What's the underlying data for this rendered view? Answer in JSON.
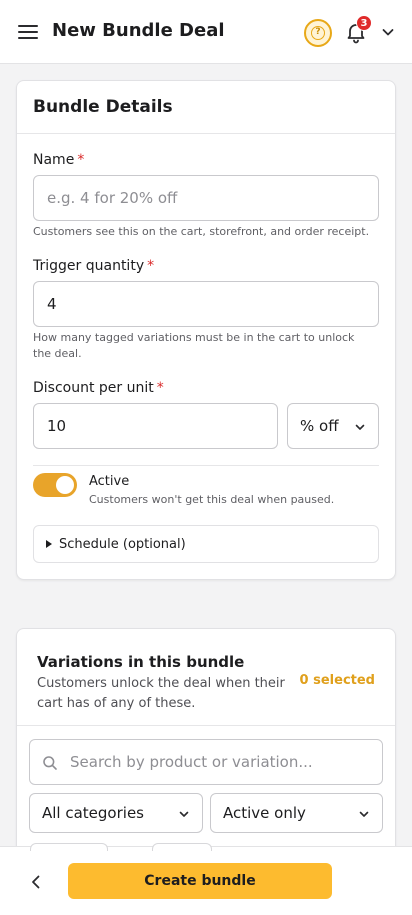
{
  "header": {
    "title": "New Bundle Deal",
    "notification_count": "3",
    "accent_color": "#e8a817",
    "badge_color": "#e02a2a"
  },
  "details": {
    "section_title": "Bundle Details",
    "name": {
      "label": "Name",
      "required_mark": "*",
      "placeholder": "e.g. 4 for 20% off",
      "value": "",
      "help": "Customers see this on the cart, storefront, and order receipt."
    },
    "trigger": {
      "label": "Trigger quantity",
      "required_mark": "*",
      "value": "4",
      "help": "How many tagged variations must be in the cart to unlock the deal."
    },
    "discount": {
      "label": "Discount per unit",
      "required_mark": "*",
      "value": "10",
      "type_selected": "% off"
    },
    "active": {
      "label": "Active",
      "on": true,
      "help": "Customers won't get this deal when paused."
    },
    "schedule": {
      "label": "Schedule (optional)"
    }
  },
  "variations": {
    "title": "Variations in this bundle",
    "description": "Customers unlock the deal when their cart has of any of these.",
    "selected_count": "0 selected",
    "search_placeholder": "Search by product or variation...",
    "category_filter": "All categories",
    "status_filter": "Active only"
  },
  "footer": {
    "create_label": "Create bundle",
    "button_color": "#fdbb2f"
  }
}
